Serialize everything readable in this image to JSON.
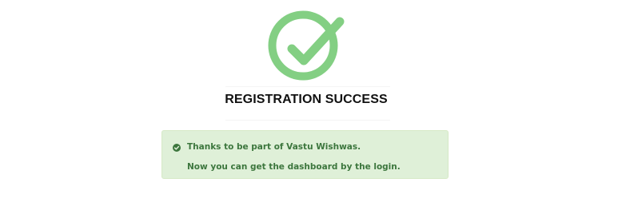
{
  "title": "REGISTRATION SUCCESS",
  "icons": {
    "hero": "check-circle-icon",
    "alert": "check-circle-small-icon"
  },
  "colors": {
    "hero_green": "#83cf83",
    "alert_bg": "#dff0d8",
    "alert_border": "#d6e9c6",
    "alert_text": "#3c763d"
  },
  "alert": {
    "line1": "Thanks to be part of Vastu Wishwas.",
    "line2": "Now you can get the dashboard by the login."
  }
}
